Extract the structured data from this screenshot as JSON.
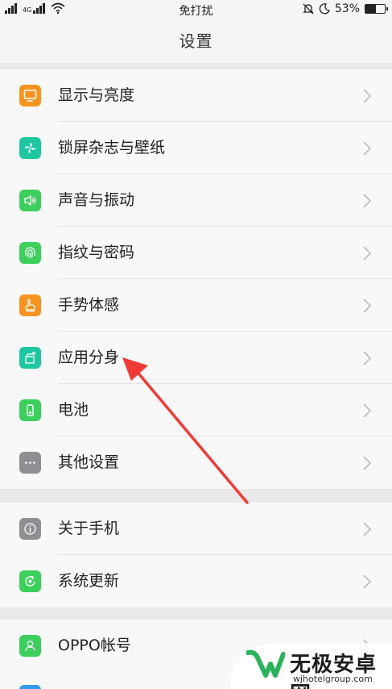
{
  "status_bar": {
    "network_label": "4G",
    "center_text": "免打扰",
    "battery_text": "53%",
    "battery_level": 0.53
  },
  "header": {
    "title": "设置"
  },
  "groups": [
    {
      "items": [
        {
          "label": "显示与亮度",
          "icon": "display-icon",
          "color": "#f7931e"
        },
        {
          "label": "锁屏杂志与壁纸",
          "icon": "pinwheel-icon",
          "color": "#1fc7a0"
        },
        {
          "label": "声音与振动",
          "icon": "speaker-icon",
          "color": "#3ccf5c"
        },
        {
          "label": "指纹与密码",
          "icon": "fingerprint-icon",
          "color": "#3ccf5c"
        },
        {
          "label": "手势体感",
          "icon": "gesture-icon",
          "color": "#f7931e"
        },
        {
          "label": "应用分身",
          "icon": "app-clone-icon",
          "color": "#1fc7a0"
        },
        {
          "label": "电池",
          "icon": "battery-icon",
          "color": "#3ccf5c"
        },
        {
          "label": "其他设置",
          "icon": "more-icon",
          "color": "#8e8e93"
        }
      ]
    },
    {
      "items": [
        {
          "label": "关于手机",
          "icon": "info-icon",
          "color": "#8e8e93"
        },
        {
          "label": "系统更新",
          "icon": "update-icon",
          "color": "#3ccf5c"
        }
      ]
    },
    {
      "items": [
        {
          "label": "OPPO帐号",
          "icon": "account-icon",
          "color": "#3ccf5c"
        }
      ]
    }
  ],
  "watermark": {
    "title": "无极安卓网",
    "url": "wjhotelgroup.com",
    "color": "#2bb35a"
  }
}
